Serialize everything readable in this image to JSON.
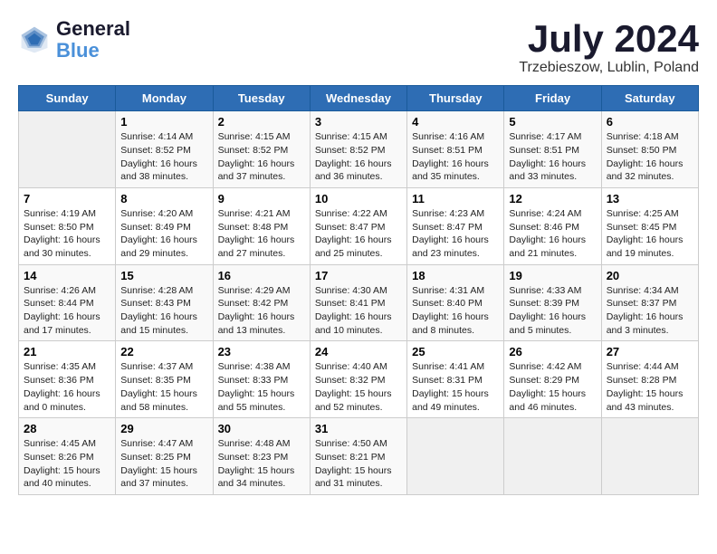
{
  "header": {
    "logo_line1": "General",
    "logo_line2": "Blue",
    "month": "July 2024",
    "location": "Trzebieszow, Lublin, Poland"
  },
  "days_of_week": [
    "Sunday",
    "Monday",
    "Tuesday",
    "Wednesday",
    "Thursday",
    "Friday",
    "Saturday"
  ],
  "weeks": [
    [
      {
        "day": "",
        "info": ""
      },
      {
        "day": "1",
        "info": "Sunrise: 4:14 AM\nSunset: 8:52 PM\nDaylight: 16 hours\nand 38 minutes."
      },
      {
        "day": "2",
        "info": "Sunrise: 4:15 AM\nSunset: 8:52 PM\nDaylight: 16 hours\nand 37 minutes."
      },
      {
        "day": "3",
        "info": "Sunrise: 4:15 AM\nSunset: 8:52 PM\nDaylight: 16 hours\nand 36 minutes."
      },
      {
        "day": "4",
        "info": "Sunrise: 4:16 AM\nSunset: 8:51 PM\nDaylight: 16 hours\nand 35 minutes."
      },
      {
        "day": "5",
        "info": "Sunrise: 4:17 AM\nSunset: 8:51 PM\nDaylight: 16 hours\nand 33 minutes."
      },
      {
        "day": "6",
        "info": "Sunrise: 4:18 AM\nSunset: 8:50 PM\nDaylight: 16 hours\nand 32 minutes."
      }
    ],
    [
      {
        "day": "7",
        "info": "Sunrise: 4:19 AM\nSunset: 8:50 PM\nDaylight: 16 hours\nand 30 minutes."
      },
      {
        "day": "8",
        "info": "Sunrise: 4:20 AM\nSunset: 8:49 PM\nDaylight: 16 hours\nand 29 minutes."
      },
      {
        "day": "9",
        "info": "Sunrise: 4:21 AM\nSunset: 8:48 PM\nDaylight: 16 hours\nand 27 minutes."
      },
      {
        "day": "10",
        "info": "Sunrise: 4:22 AM\nSunset: 8:47 PM\nDaylight: 16 hours\nand 25 minutes."
      },
      {
        "day": "11",
        "info": "Sunrise: 4:23 AM\nSunset: 8:47 PM\nDaylight: 16 hours\nand 23 minutes."
      },
      {
        "day": "12",
        "info": "Sunrise: 4:24 AM\nSunset: 8:46 PM\nDaylight: 16 hours\nand 21 minutes."
      },
      {
        "day": "13",
        "info": "Sunrise: 4:25 AM\nSunset: 8:45 PM\nDaylight: 16 hours\nand 19 minutes."
      }
    ],
    [
      {
        "day": "14",
        "info": "Sunrise: 4:26 AM\nSunset: 8:44 PM\nDaylight: 16 hours\nand 17 minutes."
      },
      {
        "day": "15",
        "info": "Sunrise: 4:28 AM\nSunset: 8:43 PM\nDaylight: 16 hours\nand 15 minutes."
      },
      {
        "day": "16",
        "info": "Sunrise: 4:29 AM\nSunset: 8:42 PM\nDaylight: 16 hours\nand 13 minutes."
      },
      {
        "day": "17",
        "info": "Sunrise: 4:30 AM\nSunset: 8:41 PM\nDaylight: 16 hours\nand 10 minutes."
      },
      {
        "day": "18",
        "info": "Sunrise: 4:31 AM\nSunset: 8:40 PM\nDaylight: 16 hours\nand 8 minutes."
      },
      {
        "day": "19",
        "info": "Sunrise: 4:33 AM\nSunset: 8:39 PM\nDaylight: 16 hours\nand 5 minutes."
      },
      {
        "day": "20",
        "info": "Sunrise: 4:34 AM\nSunset: 8:37 PM\nDaylight: 16 hours\nand 3 minutes."
      }
    ],
    [
      {
        "day": "21",
        "info": "Sunrise: 4:35 AM\nSunset: 8:36 PM\nDaylight: 16 hours\nand 0 minutes."
      },
      {
        "day": "22",
        "info": "Sunrise: 4:37 AM\nSunset: 8:35 PM\nDaylight: 15 hours\nand 58 minutes."
      },
      {
        "day": "23",
        "info": "Sunrise: 4:38 AM\nSunset: 8:33 PM\nDaylight: 15 hours\nand 55 minutes."
      },
      {
        "day": "24",
        "info": "Sunrise: 4:40 AM\nSunset: 8:32 PM\nDaylight: 15 hours\nand 52 minutes."
      },
      {
        "day": "25",
        "info": "Sunrise: 4:41 AM\nSunset: 8:31 PM\nDaylight: 15 hours\nand 49 minutes."
      },
      {
        "day": "26",
        "info": "Sunrise: 4:42 AM\nSunset: 8:29 PM\nDaylight: 15 hours\nand 46 minutes."
      },
      {
        "day": "27",
        "info": "Sunrise: 4:44 AM\nSunset: 8:28 PM\nDaylight: 15 hours\nand 43 minutes."
      }
    ],
    [
      {
        "day": "28",
        "info": "Sunrise: 4:45 AM\nSunset: 8:26 PM\nDaylight: 15 hours\nand 40 minutes."
      },
      {
        "day": "29",
        "info": "Sunrise: 4:47 AM\nSunset: 8:25 PM\nDaylight: 15 hours\nand 37 minutes."
      },
      {
        "day": "30",
        "info": "Sunrise: 4:48 AM\nSunset: 8:23 PM\nDaylight: 15 hours\nand 34 minutes."
      },
      {
        "day": "31",
        "info": "Sunrise: 4:50 AM\nSunset: 8:21 PM\nDaylight: 15 hours\nand 31 minutes."
      },
      {
        "day": "",
        "info": ""
      },
      {
        "day": "",
        "info": ""
      },
      {
        "day": "",
        "info": ""
      }
    ]
  ]
}
